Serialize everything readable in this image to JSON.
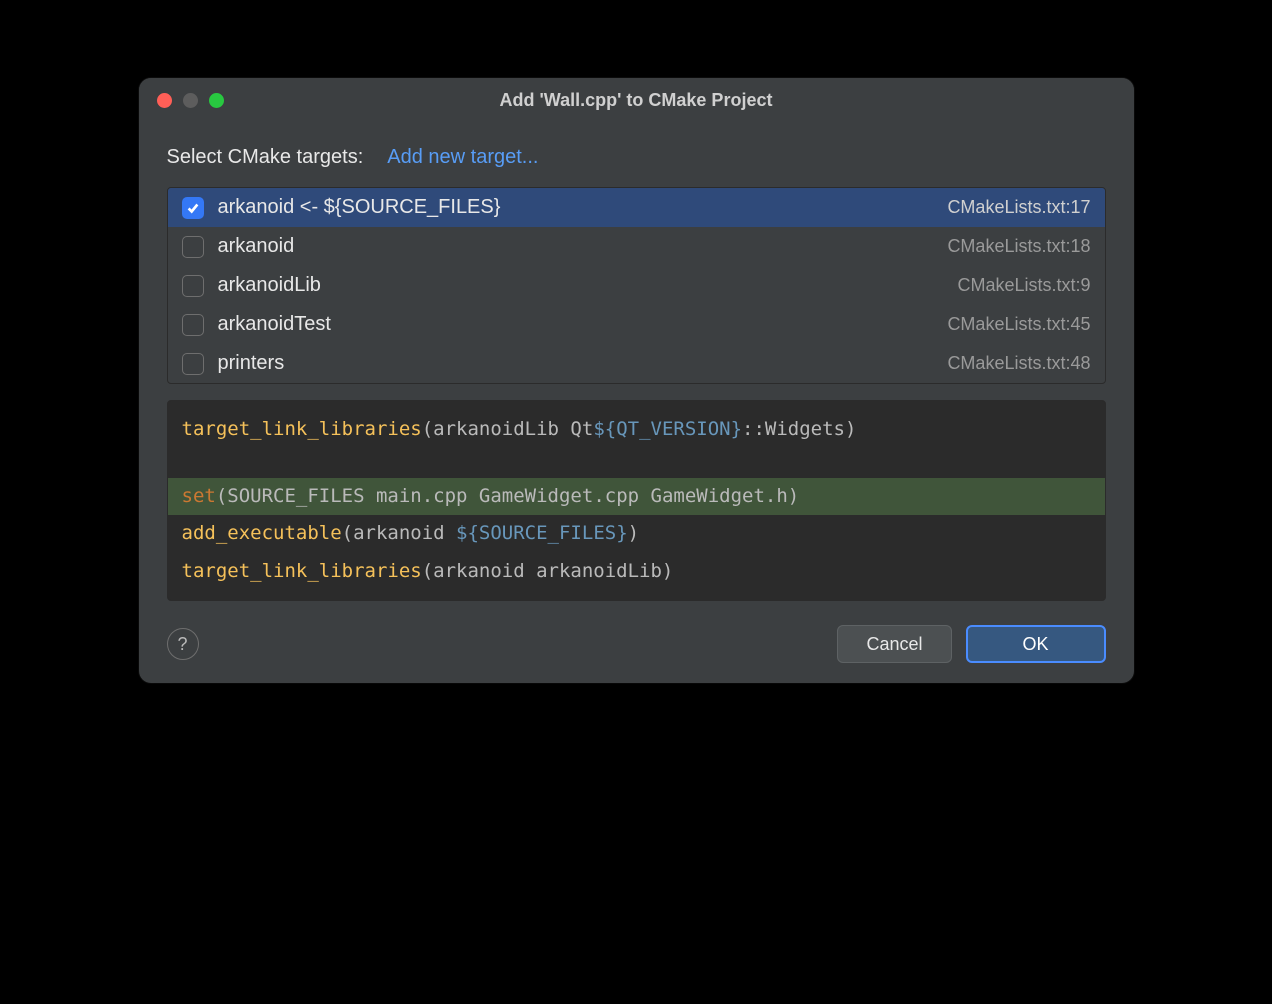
{
  "dialog": {
    "title": "Add 'Wall.cpp' to CMake Project",
    "select_label": "Select CMake targets:",
    "add_new_link": "Add new target...",
    "cancel_label": "Cancel",
    "ok_label": "OK",
    "help_label": "?"
  },
  "targets": [
    {
      "checked": true,
      "label": "arkanoid <- ${SOURCE_FILES}",
      "source": "CMakeLists.txt:17",
      "selected": true
    },
    {
      "checked": false,
      "label": "arkanoid",
      "source": "CMakeLists.txt:18",
      "selected": false
    },
    {
      "checked": false,
      "label": "arkanoidLib",
      "source": "CMakeLists.txt:9",
      "selected": false
    },
    {
      "checked": false,
      "label": "arkanoidTest",
      "source": "CMakeLists.txt:45",
      "selected": false
    },
    {
      "checked": false,
      "label": "printers",
      "source": "CMakeLists.txt:48",
      "selected": false
    }
  ],
  "code": {
    "lines": [
      {
        "highlight": false,
        "blank": false,
        "tokens": [
          {
            "t": "fn",
            "v": "target_link_libraries"
          },
          {
            "t": "plain",
            "v": "(arkanoidLib Qt"
          },
          {
            "t": "var",
            "v": "${QT_VERSION}"
          },
          {
            "t": "plain",
            "v": "::Widgets)"
          }
        ]
      },
      {
        "highlight": false,
        "blank": true,
        "tokens": []
      },
      {
        "highlight": true,
        "blank": false,
        "tokens": [
          {
            "t": "kw",
            "v": "set"
          },
          {
            "t": "plain",
            "v": "(SOURCE_FILES main.cpp GameWidget.cpp GameWidget.h)"
          }
        ]
      },
      {
        "highlight": false,
        "blank": false,
        "tokens": [
          {
            "t": "fn",
            "v": "add_executable"
          },
          {
            "t": "plain",
            "v": "(arkanoid "
          },
          {
            "t": "var",
            "v": "${SOURCE_FILES}"
          },
          {
            "t": "plain",
            "v": ")"
          }
        ]
      },
      {
        "highlight": false,
        "blank": false,
        "tokens": [
          {
            "t": "fn",
            "v": "target_link_libraries"
          },
          {
            "t": "plain",
            "v": "(arkanoid arkanoidLib)"
          }
        ]
      }
    ]
  }
}
